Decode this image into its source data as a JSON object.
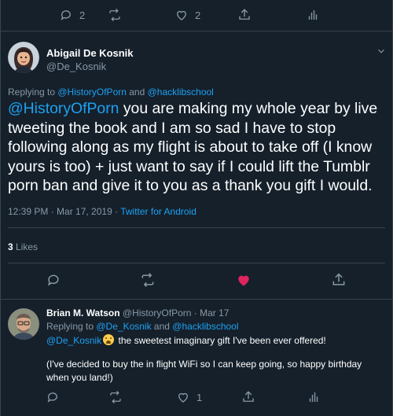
{
  "top_actions": {
    "reply_count": "2",
    "like_count": "2"
  },
  "main_tweet": {
    "name": "Abigail De Kosnik",
    "handle": "@De_Kosnik",
    "replying_prefix": "Replying to ",
    "replying_to_1": "@HistoryOfPorn",
    "replying_and": " and ",
    "replying_to_2": "@hacklibschool",
    "text_mention": "@HistoryOfPorn",
    "text_body": " you are making my whole year by live tweeting the book and I am so sad I have to stop following along as my flight is about to take off (I know yours is too) + just want to say if I could lift the Tumblr porn ban and give it to you as a thank you gift I would.",
    "timestamp": "12:39 PM · Mar 17, 2019 · ",
    "source": "Twitter for Android",
    "likes_count": "3",
    "likes_label": " Likes"
  },
  "reply_tweet": {
    "name": "Brian M. Watson",
    "handle_date": " @HistoryOfPorn · Mar 17",
    "replying_prefix": "Replying to ",
    "replying_to_1": "@De_Kosnik",
    "replying_and": " and ",
    "replying_to_2": "@hacklibschool",
    "line1_mention": "@De_Kosnik",
    "line1_text": " the sweetest imaginary gift I've been ever offered!",
    "line2": "(I've decided to buy the in flight WiFi so I can keep going, so happy birthday",
    "line3": "when you land!)",
    "like_count": "1"
  },
  "colors": {
    "background": "#15202b",
    "border": "#38444d",
    "muted": "#8899a6",
    "link": "#1da1f2",
    "heart": "#e0245e"
  },
  "icons": [
    "reply-icon",
    "retweet-icon",
    "like-icon",
    "share-icon",
    "analytics-icon",
    "chevron-down-icon",
    "heart-filled-icon"
  ]
}
